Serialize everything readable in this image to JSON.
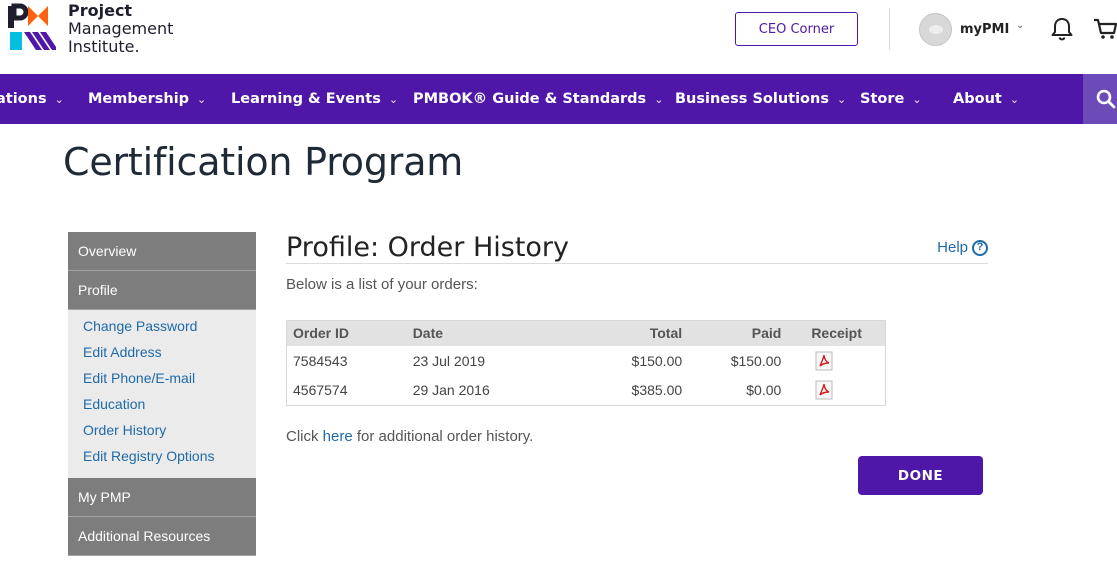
{
  "header": {
    "logo": {
      "line1": "Project",
      "line2": "Management",
      "line3": "Institute."
    },
    "ceo_button": "CEO Corner",
    "user_label": "myPMI",
    "icons": {
      "notifications": "bell-icon",
      "cart": "cart-icon",
      "search": "search-icon"
    }
  },
  "nav": {
    "items": [
      {
        "label": "ations"
      },
      {
        "label": "Membership"
      },
      {
        "label": "Learning & Events"
      },
      {
        "label": "PMBOK® Guide & Standards"
      },
      {
        "label": "Business Solutions"
      },
      {
        "label": "Store"
      },
      {
        "label": "About"
      }
    ]
  },
  "page_title": "Certification Program",
  "sidebar": {
    "items": [
      {
        "label": "Overview"
      },
      {
        "label": "Profile"
      },
      {
        "label": "My PMP"
      },
      {
        "label": "Additional Resources"
      }
    ],
    "profile_links": [
      {
        "label": "Change Password"
      },
      {
        "label": "Edit Address"
      },
      {
        "label": "Edit Phone/E-mail"
      },
      {
        "label": "Education"
      },
      {
        "label": "Order History"
      },
      {
        "label": "Edit Registry Options"
      }
    ]
  },
  "main": {
    "title": "Profile: Order History",
    "help_label": "Help",
    "intro": "Below is a list of your orders:",
    "table": {
      "headers": [
        "Order ID",
        "Date",
        "Total",
        "Paid",
        "Receipt"
      ],
      "rows": [
        {
          "order_id": "7584543",
          "date": "23 Jul 2019",
          "total": "$150.00",
          "paid": "$150.00",
          "receipt_icon": "pdf-icon"
        },
        {
          "order_id": "4567574",
          "date": "29 Jan 2016",
          "total": "$385.00",
          "paid": "$0.00",
          "receipt_icon": "pdf-icon"
        }
      ]
    },
    "more_prefix": "Click ",
    "more_link": "here",
    "more_suffix": " for additional order history.",
    "done_button": "DONE"
  },
  "colors": {
    "brand_purple": "#4f17a8",
    "link_blue": "#1f6aa8",
    "sidebar_gray": "#7d7d7d",
    "sidebar_sub_bg": "#ebebeb"
  }
}
